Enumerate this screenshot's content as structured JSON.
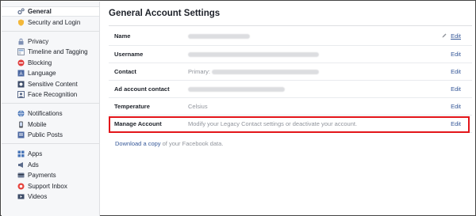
{
  "sidebar": {
    "groups": [
      [
        {
          "label": "General",
          "icon": "gear-icon",
          "active": true
        },
        {
          "label": "Security and Login",
          "icon": "shield-icon"
        }
      ],
      [
        {
          "label": "Privacy",
          "icon": "lock-icon"
        },
        {
          "label": "Timeline and Tagging",
          "icon": "timeline-icon"
        },
        {
          "label": "Blocking",
          "icon": "block-icon"
        },
        {
          "label": "Language",
          "icon": "language-icon"
        },
        {
          "label": "Sensitive Content",
          "icon": "sensitive-content-icon"
        },
        {
          "label": "Face Recognition",
          "icon": "face-recognition-icon"
        }
      ],
      [
        {
          "label": "Notifications",
          "icon": "globe-icon"
        },
        {
          "label": "Mobile",
          "icon": "mobile-icon"
        },
        {
          "label": "Public Posts",
          "icon": "public-posts-icon"
        }
      ],
      [
        {
          "label": "Apps",
          "icon": "apps-icon"
        },
        {
          "label": "Ads",
          "icon": "ads-icon"
        },
        {
          "label": "Payments",
          "icon": "payments-icon"
        },
        {
          "label": "Support Inbox",
          "icon": "support-inbox-icon"
        },
        {
          "label": "Videos",
          "icon": "videos-icon"
        }
      ]
    ]
  },
  "main": {
    "title": "General Account Settings",
    "rows": [
      {
        "label": "Name",
        "value": "",
        "edit": "Edit"
      },
      {
        "label": "Username",
        "value": "",
        "edit": "Edit"
      },
      {
        "label": "Contact",
        "value": "Primary:",
        "edit": "Edit"
      },
      {
        "label": "Ad account contact",
        "value": "",
        "edit": "Edit"
      },
      {
        "label": "Temperature",
        "value": "Celsius",
        "edit": "Edit"
      },
      {
        "label": "Manage Account",
        "value": "Modify your Legacy Contact settings or deactivate your account.",
        "edit": "Edit"
      }
    ],
    "download": {
      "link": "Download a copy",
      "rest": " of your Facebook data."
    }
  },
  "colors": {
    "link": "#365899",
    "highlight": "#e3151a",
    "sidebar_bg": "#f6f7f9"
  }
}
